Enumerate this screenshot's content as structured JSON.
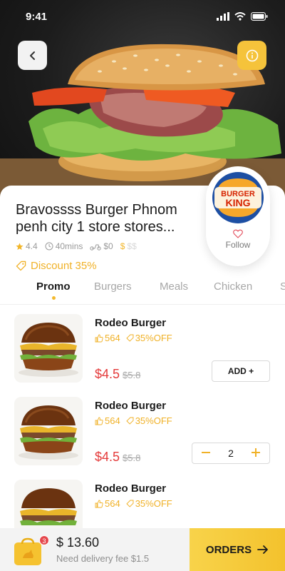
{
  "status_bar": {
    "time": "9:41"
  },
  "hero": {
    "back_icon": "chevron-left-icon",
    "info_icon": "info-icon"
  },
  "store": {
    "name": "Bravossss Burger Phnom penh city 1 store stores...",
    "rating": "4.4",
    "time": "40mins",
    "delivery_fee": "$0",
    "price_level_active": "$",
    "price_level_inactive": "$$",
    "discount": "Discount 35%",
    "brand_logo_text_1": "BURGER",
    "brand_logo_text_2": "KING",
    "follow_label": "Follow"
  },
  "tabs": [
    {
      "label": "Promo"
    },
    {
      "label": "Burgers"
    },
    {
      "label": "Meals"
    },
    {
      "label": "Chicken"
    },
    {
      "label": "S"
    }
  ],
  "items": [
    {
      "name": "Rodeo Burger",
      "likes": "564",
      "discount": "35%OFF",
      "price": "$4.5",
      "old_price": "$5.8",
      "action": "ADD +"
    },
    {
      "name": "Rodeo Burger",
      "likes": "564",
      "discount": "35%OFF",
      "price": "$4.5",
      "old_price": "$5.8",
      "quantity": "2"
    },
    {
      "name": "Rodeo Burger",
      "likes": "564",
      "discount": "35%OFF"
    }
  ],
  "cart": {
    "badge_count": "3",
    "total": "$ 13.60",
    "delivery_note": "Need delivery fee $1.5",
    "orders_label": "ORDERS",
    "orders_icon": "arrow-right-icon"
  },
  "colors": {
    "accent": "#f3c22d",
    "price": "#e43a3a",
    "discount": "#f0b127"
  }
}
